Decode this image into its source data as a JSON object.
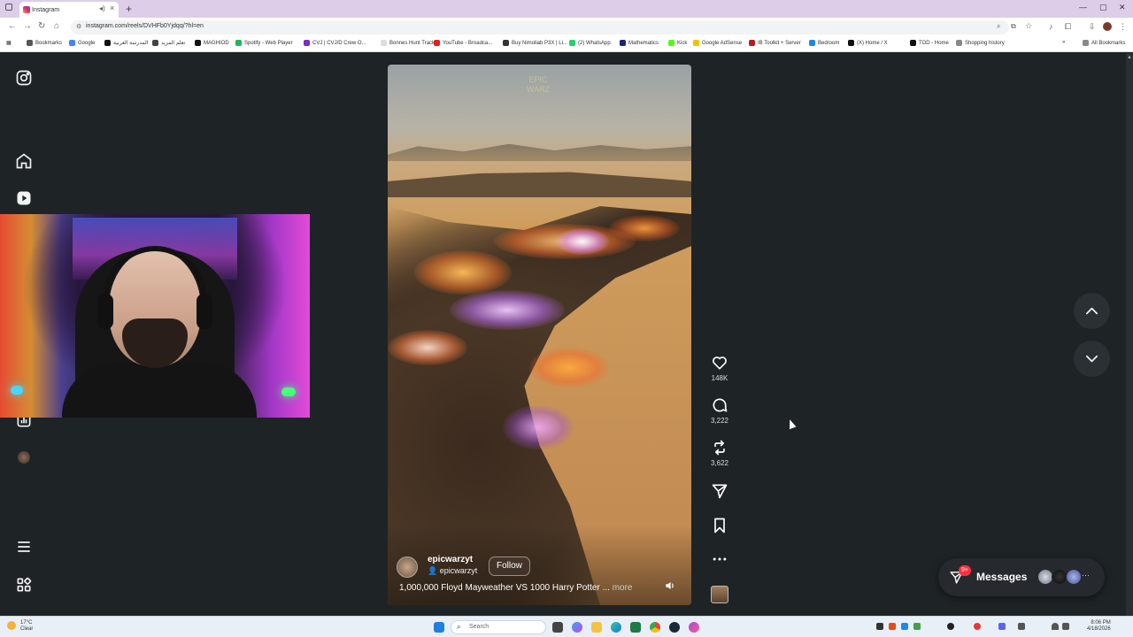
{
  "browser": {
    "tab_title": "Instagram",
    "new_tab_glyph": "+",
    "url": "instagram.com/reels/DVHFb0Yjdqq/?hl=en",
    "bookmarks": [
      {
        "label": "Bookmarks",
        "color": "#555555"
      },
      {
        "label": "Google",
        "color": "#4285f4"
      },
      {
        "label": "المدرسة العربية",
        "color": "#111111"
      },
      {
        "label": "تعلم المزيد",
        "color": "#444444"
      },
      {
        "label": "MAGHIOD",
        "color": "#111111"
      },
      {
        "label": "Spotify - Web Player",
        "color": "#1db954"
      },
      {
        "label": "CVJ | CVJ/D Crew O...",
        "color": "#7b2ec1"
      },
      {
        "label": "Bonnes Hunt Tracker",
        "color": "#dddddd"
      },
      {
        "label": "YouTube - Broadca...",
        "color": "#e62117"
      },
      {
        "label": "Buy Nimoliab P3X | Li...",
        "color": "#333333"
      },
      {
        "label": "(2) WhatsApp",
        "color": "#25d366"
      },
      {
        "label": "Mathematics",
        "color": "#1a237e"
      },
      {
        "label": "Kick",
        "color": "#53fc18"
      },
      {
        "label": "Google AdSense",
        "color": "#fbbc04"
      },
      {
        "label": "IB Toolkit + Server",
        "color": "#b71c1c"
      },
      {
        "label": "Bedroom",
        "color": "#1e88e5"
      },
      {
        "label": "(X) Home / X",
        "color": "#111111"
      },
      {
        "label": "TOD - Home",
        "color": "#111111"
      },
      {
        "label": "Shopping history",
        "color": "#888888"
      }
    ],
    "all_bookmarks": "All Bookmarks"
  },
  "reel": {
    "watermark": "EPIC WARZ",
    "author": "epicwarzyt",
    "audio_author": "epicwarzyt",
    "follow_label": "Follow",
    "caption": "1,000,000 Floyd Mayweather VS 1000 Harry Potter ...",
    "more_label": "more",
    "likes": "148K",
    "comments": "3,222",
    "reposts": "3,622"
  },
  "messages": {
    "label": "Messages",
    "badge": "9+"
  },
  "taskbar": {
    "temp": "17°C",
    "condition": "Clear",
    "search_placeholder": "Search",
    "time": "8:06 PM",
    "date": "4/18/2026"
  },
  "icons": {
    "instagram": "instagram-logo-icon",
    "home": "home-icon",
    "reels": "reels-icon",
    "like": "heart-icon",
    "comment": "comment-icon",
    "repost": "repost-icon",
    "share": "share-icon",
    "save": "bookmark-icon",
    "more": "more-icon"
  }
}
